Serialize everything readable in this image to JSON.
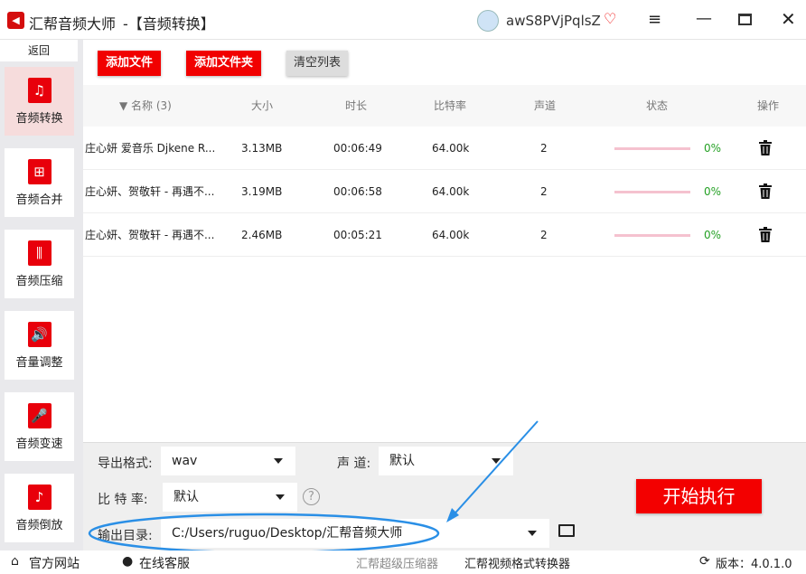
{
  "titlebar": {
    "app_name": "汇帮音频大师",
    "page": "-【音频转换】",
    "username": "awS8PVjPqlsZ"
  },
  "sidebar": {
    "back": "返回",
    "items": [
      {
        "label": "音频转换",
        "icon": "♫"
      },
      {
        "label": "音频合并",
        "icon": "⊞"
      },
      {
        "label": "音频压缩",
        "icon": "⫼"
      },
      {
        "label": "音量调整",
        "icon": "🔊"
      },
      {
        "label": "音频变速",
        "icon": "🎤"
      },
      {
        "label": "音频倒放",
        "icon": "♪"
      }
    ]
  },
  "toolbar": {
    "add_file": "添加文件",
    "add_folder": "添加文件夹",
    "clear": "清空列表"
  },
  "table": {
    "headers": {
      "name": "名称 (3)",
      "size": "大小",
      "duration": "时长",
      "bitrate": "比特率",
      "channel": "声道",
      "status": "状态",
      "action": "操作"
    },
    "rows": [
      {
        "name": "庄心妍 爱音乐 Djkene R...",
        "size": "3.13MB",
        "duration": "00:06:49",
        "bitrate": "64.00k",
        "channel": "2",
        "progress": "0%"
      },
      {
        "name": "庄心妍、贺敬轩 - 再遇不...",
        "size": "3.19MB",
        "duration": "00:06:58",
        "bitrate": "64.00k",
        "channel": "2",
        "progress": "0%"
      },
      {
        "name": "庄心妍、贺敬轩 - 再遇不...",
        "size": "2.46MB",
        "duration": "00:05:21",
        "bitrate": "64.00k",
        "channel": "2",
        "progress": "0%"
      }
    ]
  },
  "settings": {
    "format_label": "导出格式:",
    "format_value": "wav",
    "channel_label": "声 道:",
    "channel_value": "默认",
    "bitrate_label": "比 特 率:",
    "bitrate_value": "默认",
    "help": "?",
    "output_label": "输出目录:",
    "output_value": "C:/Users/ruguo/Desktop/汇帮音频大师"
  },
  "start": "开始执行",
  "footer": {
    "website": "官方网站",
    "support": "在线客服",
    "link1": "汇帮超级压缩器",
    "link2": "汇帮视频格式转换器",
    "version": "版本：4.0.1.0"
  }
}
